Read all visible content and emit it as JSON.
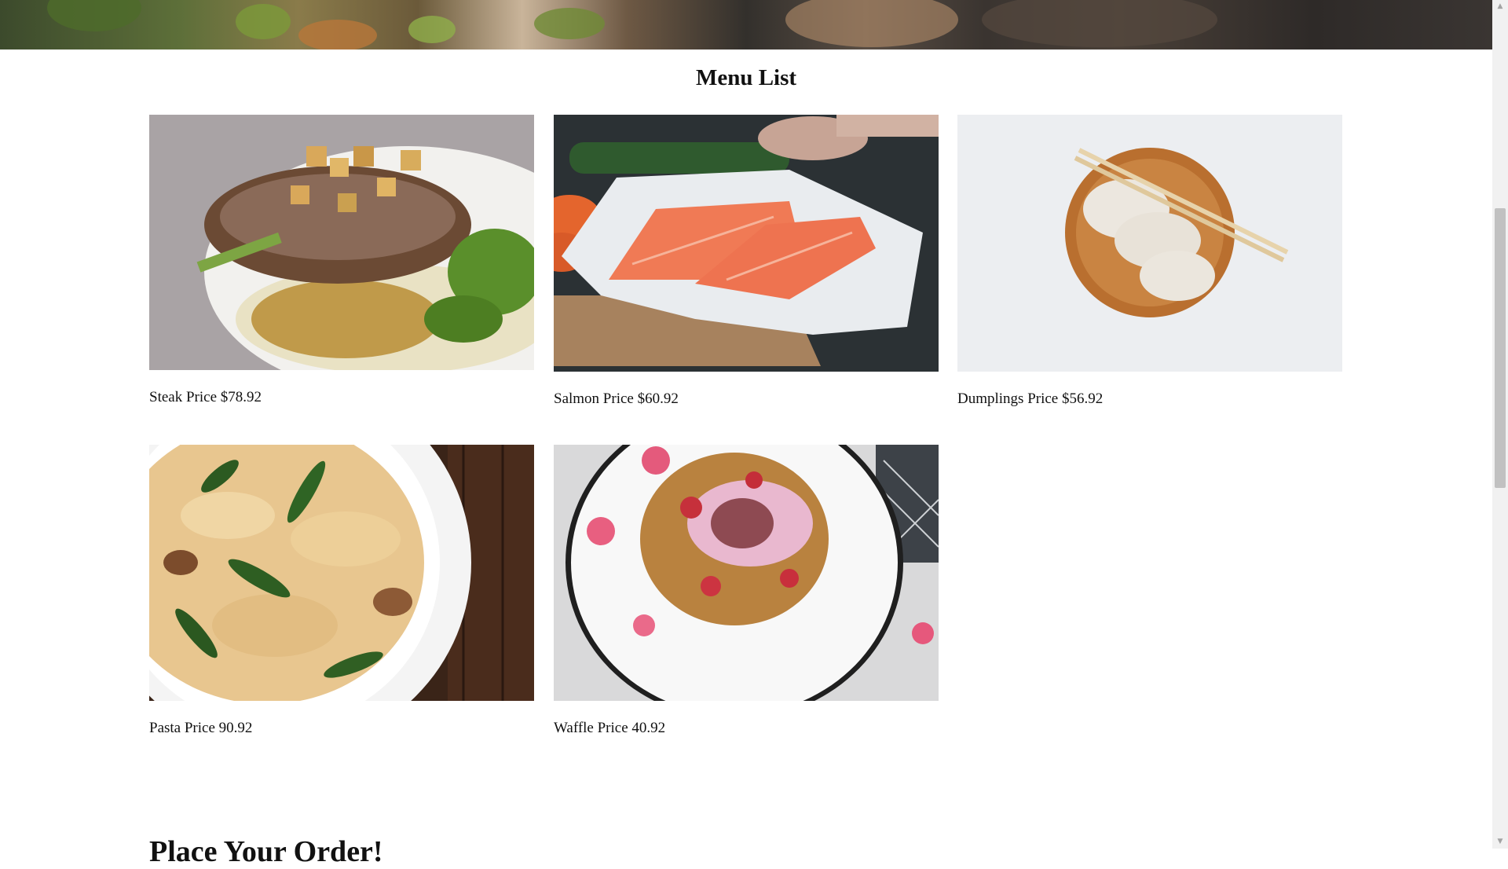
{
  "page": {
    "menu_title": "Menu List",
    "next_section_heading": "Place Your Order!"
  },
  "menu": {
    "items": [
      {
        "name": "Steak",
        "price_label": "Price $78.92",
        "caption": "Steak Price $78.92"
      },
      {
        "name": "Salmon",
        "price_label": "Price $60.92",
        "caption": "Salmon Price $60.92"
      },
      {
        "name": "Dumplings",
        "price_label": "Price $56.92",
        "caption": "Dumplings Price $56.92"
      },
      {
        "name": "Pasta",
        "price_label": "Price 90.92",
        "caption": "Pasta Price 90.92"
      },
      {
        "name": "Waffle",
        "price_label": "Price 40.92",
        "caption": "Waffle Price 40.92"
      }
    ]
  },
  "scrollbar": {
    "up_icon": "triangle-up-icon",
    "down_icon": "triangle-down-icon",
    "position_fraction": 0.3
  }
}
